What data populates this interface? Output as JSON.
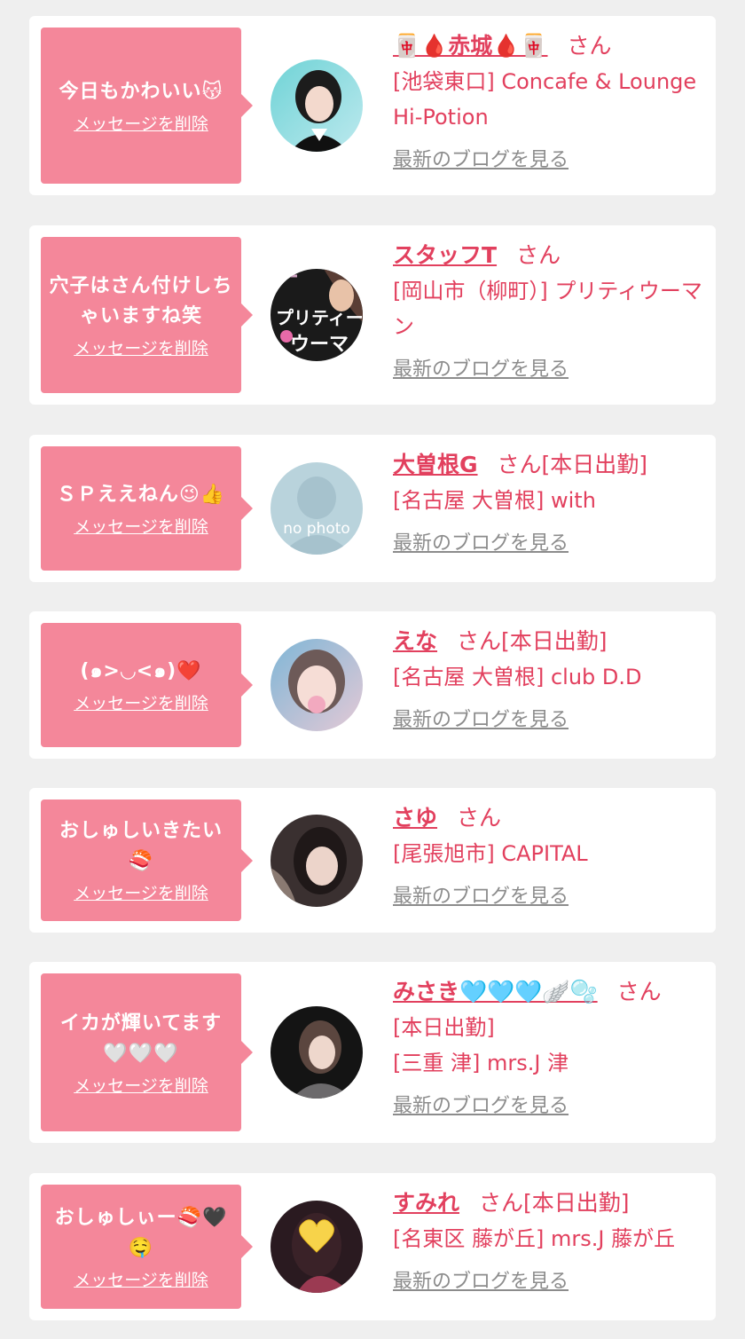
{
  "delete_label": "メッセージを削除",
  "blog_label": "最新のブログを見る",
  "san_label": "さん",
  "colors": {
    "accent": "#e2405e",
    "bubble": "#f4879a",
    "background": "#efefef",
    "card": "#ffffff",
    "link_gray": "#8c8c8c"
  },
  "items": [
    {
      "message": "今日もかわいい😽",
      "name": "🀄🩸赤城🩸🀄",
      "status": "",
      "shop": "[池袋東口] Concafe & Lounge Hi-Potion",
      "avatar_icon": "girl-photo-1"
    },
    {
      "message": "穴子はさん付けしちゃいますね笑",
      "name": "スタッフT",
      "status": "",
      "shop": "[岡山市（柳町）] プリティウーマン",
      "avatar_icon": "shop-logo-pretty-woman"
    },
    {
      "message": "ＳＰええねん😉👍",
      "name": "大曽根G",
      "status": "[本日出勤]",
      "shop": "[名古屋 大曽根] with",
      "avatar_icon": "no-photo-placeholder",
      "avatar_text": "no photo"
    },
    {
      "message": "(๑>◡<๑)❤️",
      "name": "えな",
      "status": "[本日出勤]",
      "shop": "[名古屋 大曽根] club D.D",
      "avatar_icon": "girl-photo-4"
    },
    {
      "message": "おしゅしいきたい🍣",
      "name": "さゆ",
      "status": "",
      "shop": "[尾張旭市] CAPITAL",
      "avatar_icon": "girl-photo-5"
    },
    {
      "message": "イカが輝いてます🤍🤍🤍",
      "name": "みさき🩵🩵🩵🪽🫧",
      "status": "[本日出勤]",
      "shop": "[三重 津] mrs.J 津",
      "avatar_icon": "girl-photo-6"
    },
    {
      "message": "おしゅしぃー🍣🖤🤤",
      "name": "すみれ",
      "status": "[本日出勤]",
      "shop": "[名東区 藤が丘] mrs.J 藤が丘",
      "avatar_icon": "girl-photo-7-heart-sticker"
    }
  ]
}
